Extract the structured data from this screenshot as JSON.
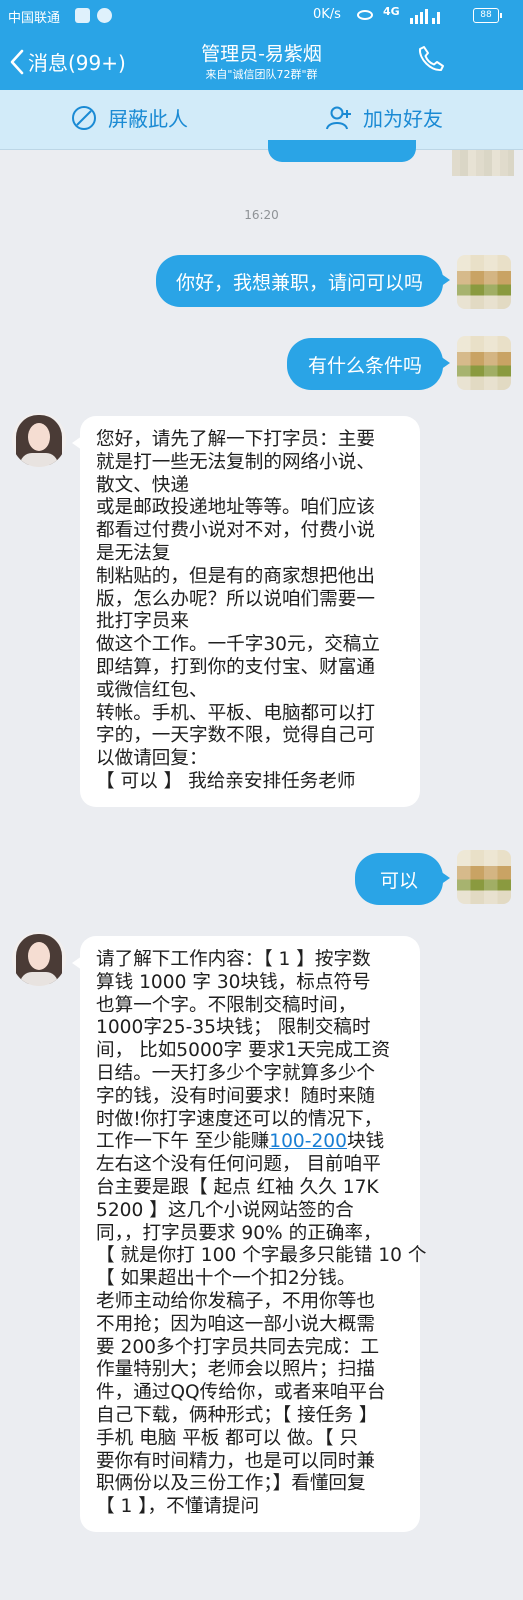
{
  "status_bar": {
    "carrier": "中国联通",
    "speed": "0K/s",
    "network": "4G",
    "battery": "88"
  },
  "nav": {
    "back_label": "消息(99+)",
    "title": "管理员-易紫烟",
    "subtitle": "来自\"诚信团队72群\"群"
  },
  "actions": {
    "block_label": "屏蔽此人",
    "add_friend_label": "加为好友"
  },
  "timestamp": "16:20",
  "messages": [
    {
      "direction": "out",
      "text": "你好，我想兼职，请问可以吗"
    },
    {
      "direction": "out",
      "text": "有什么条件吗"
    },
    {
      "direction": "in",
      "lines": [
        "您好，请先了解一下打字员：主要",
        "就是打一些无法复制的网络小说、",
        "散文、快递",
        "或是邮政投递地址等等。咱们应该",
        "都看过付费小说对不对，付费小说",
        "是无法复",
        "制粘贴的，但是有的商家想把他出",
        "版，怎么办呢？所以说咱们需要一",
        "批打字员来",
        "做这个工作。一千字30元，交稿立",
        "即结算，打到你的支付宝、财富通",
        "或微信红包、",
        "转帐。手机、平板、电脑都可以打",
        "字的，一天字数不限，觉得自己可",
        "以做请回复：",
        "【 可以 】    我给亲安排任务老师"
      ]
    },
    {
      "direction": "out",
      "text": "可以"
    },
    {
      "direction": "in",
      "lines": [
        "请了解下工作内容：【 1 】按字数",
        "算钱 1000 字 30块钱，标点符号",
        "也算一个字。不限制交稿时间，",
        "1000字25-35块钱；  限制交稿时",
        "间， 比如5000字 要求1天完成工资",
        "日结。一天打多少个字就算多少个",
        "字的钱，没有时间要求！随时来随",
        "时做!你打字速度还可以的情况下，",
        "工作一下午  至少能赚",
        "左右这个没有任何问题， 目前咱平",
        "台主要是跟【 起点 红袖  久久  17K",
        "5200 】这几个小说网站签的合",
        "同，，打字员要求 90% 的正确率，",
        "【 就是你打 100 个字最多只能错 10 个",
        "【 如果超出十个一个扣2分钱。",
        "老师主动给你发稿子，不用你等也",
        "不用抢；因为咱这一部小说大概需",
        "要  200多个打字员共同去完成：工",
        "作量特别大；老师会以照片；扫描",
        "件，通过QQ传给你，或者来咱平台",
        "自己下载，俩种形式；【 接任务 】",
        "手机 电脑 平板 都可以  做。【 只",
        "要你有时间精力，也是可以同时兼",
        "职俩份以及三份工作；】看懂回复",
        "【 1 】，不懂请提问"
      ],
      "link_text": "100-200",
      "link_suffix": "块钱"
    }
  ]
}
